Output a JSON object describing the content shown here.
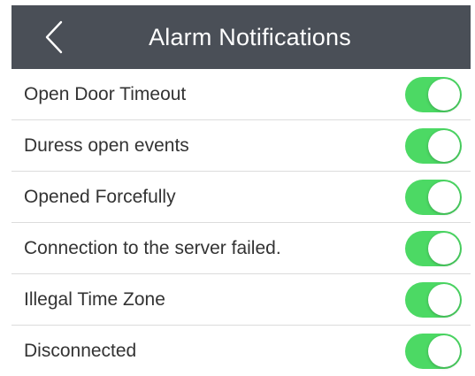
{
  "header": {
    "title": "Alarm Notifications",
    "background": "#4a4f57",
    "back_icon": "chevron-left-icon"
  },
  "colors": {
    "switch_on": "#4cd964",
    "switch_off": "#e5e5e5",
    "label_text": "#333333",
    "divider": "#dcdcdc"
  },
  "settings": [
    {
      "label": "Open Door Timeout",
      "enabled": true
    },
    {
      "label": "Duress open events",
      "enabled": true
    },
    {
      "label": "Opened Forcefully",
      "enabled": true
    },
    {
      "label": "Connection to the server failed.",
      "enabled": true
    },
    {
      "label": "Illegal Time Zone",
      "enabled": true
    },
    {
      "label": "Disconnected",
      "enabled": true
    }
  ]
}
